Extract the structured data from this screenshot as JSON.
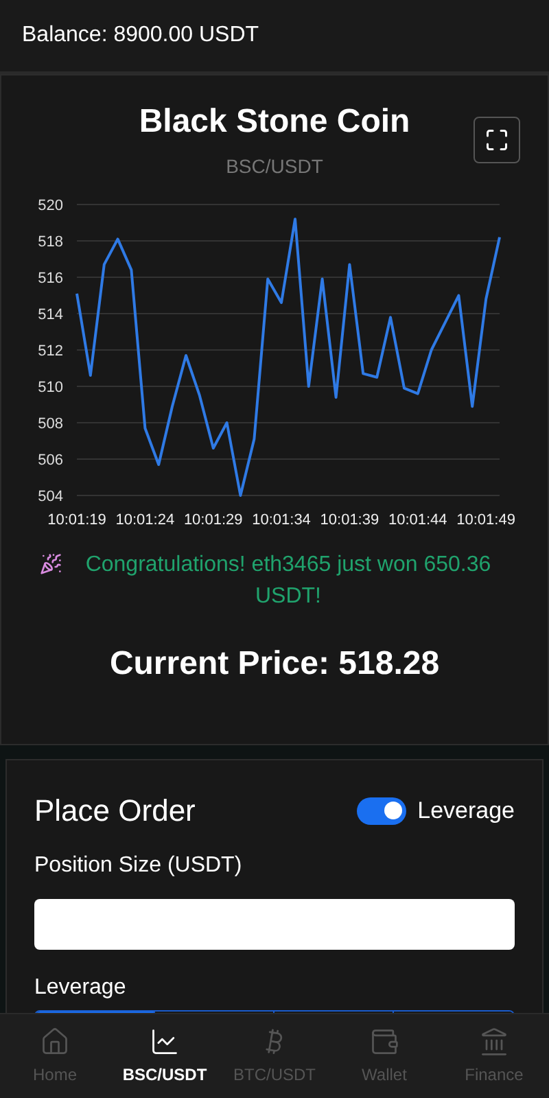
{
  "header": {
    "balance": "Balance: 8900.00 USDT"
  },
  "coin_card": {
    "title": "Black Stone Coin",
    "pair": "BSC/USDT",
    "chart_data": {
      "type": "line",
      "categories": [
        "10:01:19",
        null,
        null,
        null,
        null,
        "10:01:24",
        null,
        null,
        null,
        null,
        "10:01:29",
        null,
        null,
        null,
        null,
        "10:01:34",
        null,
        null,
        null,
        null,
        "10:01:39",
        null,
        null,
        null,
        null,
        "10:01:44",
        null,
        null,
        null,
        null,
        "10:01:49",
        null
      ],
      "series": [
        {
          "color": "#2f7ae5",
          "values": [
            515.1,
            510.6,
            516.7,
            518.1,
            516.4,
            507.7,
            505.7,
            508.9,
            511.7,
            509.5,
            506.6,
            508.0,
            504.0,
            507.1,
            515.9,
            514.6,
            519.2,
            510.0,
            515.9,
            509.4,
            516.7,
            510.7,
            510.5,
            513.8,
            509.9,
            509.6,
            512.0,
            513.5,
            515.0,
            508.9,
            514.8,
            518.2
          ]
        }
      ],
      "grid": true,
      "ylim": [
        504,
        520
      ],
      "yticks": [
        504,
        506,
        508,
        510,
        512,
        514,
        516,
        518,
        520
      ]
    },
    "announcement": "Congratulations! eth3465 just won 650.36 USDT!",
    "current_price": "Current Price: 518.28"
  },
  "order": {
    "title": "Place Order",
    "leverage_switch": {
      "label": "Leverage",
      "on": true
    },
    "position_label": "Position Size (USDT)",
    "leverage_label": "Leverage",
    "leverage_options": [
      {
        "selected": true
      },
      {
        "selected": false
      },
      {
        "selected": false
      },
      {
        "selected": false
      }
    ]
  },
  "nav": [
    {
      "label": "Home",
      "selected": false
    },
    {
      "label": "BSC/USDT",
      "selected": true
    },
    {
      "label": "BTC/USDT",
      "selected": false
    },
    {
      "label": "Wallet",
      "selected": false
    },
    {
      "label": "Finance",
      "selected": false
    }
  ]
}
